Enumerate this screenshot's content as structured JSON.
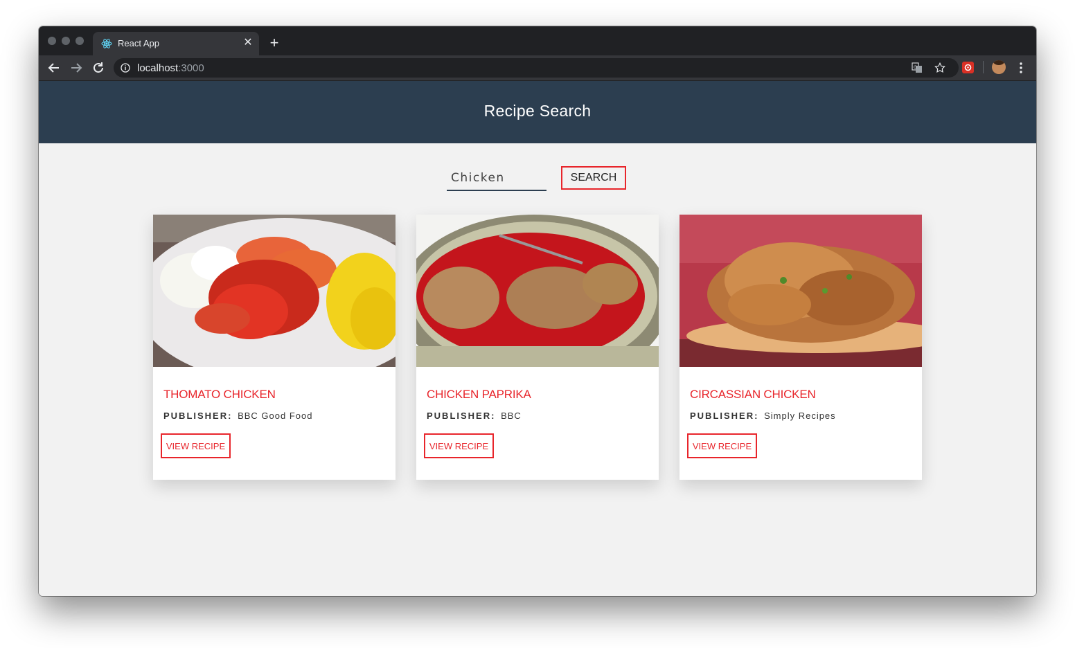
{
  "browser": {
    "tab_title": "React App",
    "url_host": "localhost",
    "url_port": ":3000"
  },
  "app": {
    "title": "Recipe Search",
    "search": {
      "value": "Chicken",
      "button_label": "SEARCH"
    },
    "publisher_label": "PUBLISHER:",
    "recipes": [
      {
        "title": "THOMATO CHICKEN",
        "publisher": "BBC Good Food",
        "button": "VIEW RECIPE"
      },
      {
        "title": "CHICKEN PAPRIKA",
        "publisher": "BBC",
        "button": "VIEW RECIPE"
      },
      {
        "title": "CIRCASSIAN CHICKEN",
        "publisher": "Simply Recipes",
        "button": "VIEW RECIPE"
      }
    ]
  },
  "colors": {
    "navbar": "#2c3e50",
    "accent": "#e8252b",
    "page_bg": "#f2f2f2"
  },
  "icons": [
    "react-favicon-icon",
    "close-icon",
    "plus-icon",
    "back-icon",
    "forward-icon",
    "reload-icon",
    "info-icon",
    "translate-icon",
    "star-icon",
    "extension-icon",
    "profile-avatar",
    "menu-kebab-icon"
  ]
}
